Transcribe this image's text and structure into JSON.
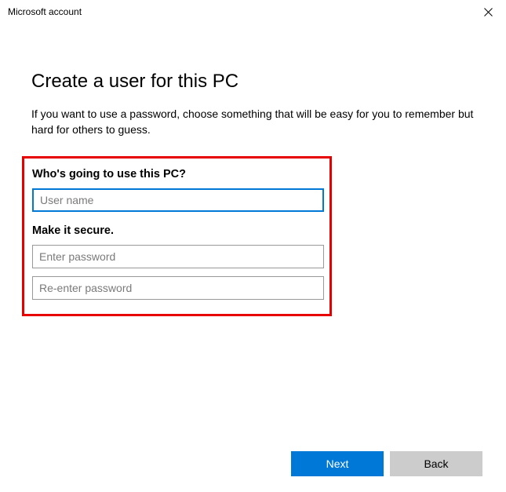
{
  "titlebar": {
    "title": "Microsoft account"
  },
  "main": {
    "heading": "Create a user for this PC",
    "description": "If you want to use a password, choose something that will be easy for you to remember but hard for others to guess."
  },
  "form": {
    "section1_label": "Who's going to use this PC?",
    "username": {
      "value": "",
      "placeholder": "User name"
    },
    "section2_label": "Make it secure.",
    "password": {
      "value": "",
      "placeholder": "Enter password"
    },
    "password_confirm": {
      "value": "",
      "placeholder": "Re-enter password"
    }
  },
  "buttons": {
    "next": "Next",
    "back": "Back"
  }
}
